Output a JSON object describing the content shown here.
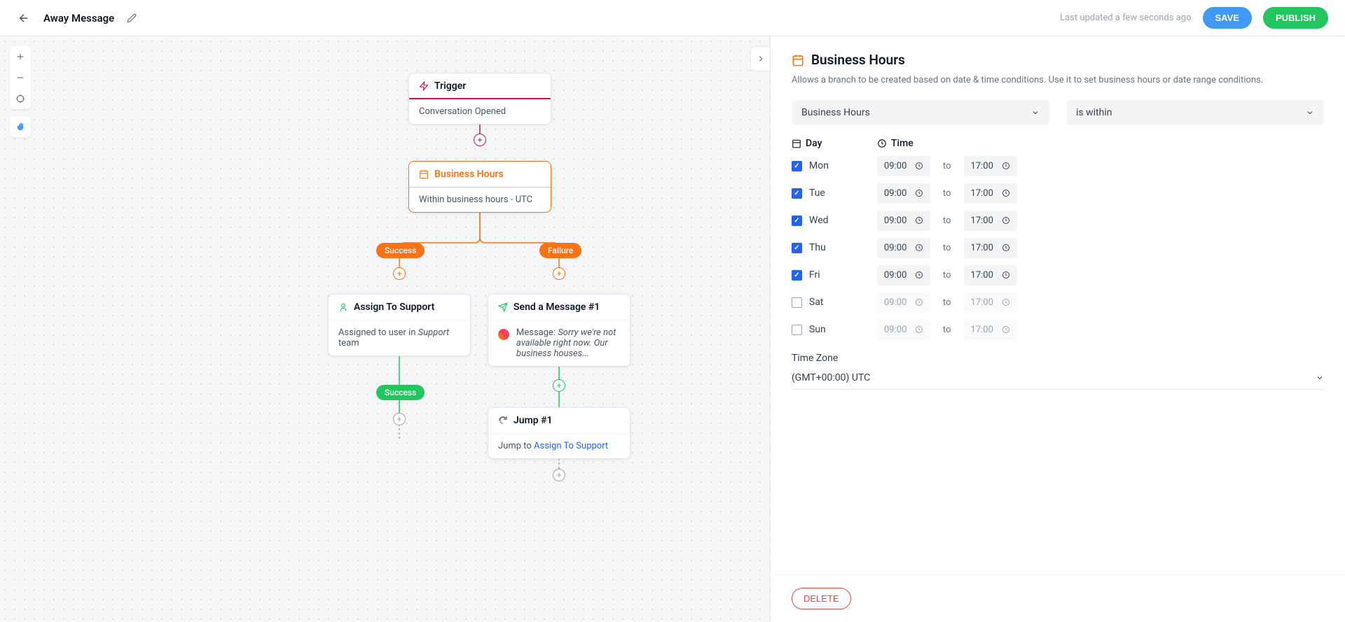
{
  "header": {
    "title": "Away Message",
    "last_updated": "Last updated a few seconds ago",
    "save": "SAVE",
    "publish": "PUBLISH"
  },
  "nodes": {
    "trigger": {
      "title": "Trigger",
      "body": "Conversation Opened"
    },
    "bh": {
      "title": "Business Hours",
      "body": "Within business hours - UTC"
    },
    "assign": {
      "title": "Assign To Support",
      "body_prefix": "Assigned to user in ",
      "team": "Support",
      "body_suffix": " team"
    },
    "msg": {
      "title": "Send a Message #1",
      "label": "Message: ",
      "text": "Sorry we're not available right now. Our business houses..."
    },
    "jump": {
      "title": "Jump #1",
      "prefix": "Jump to ",
      "target": "Assign To Support"
    }
  },
  "badges": {
    "success": "Success",
    "failure": "Failure",
    "success2": "Success"
  },
  "panel": {
    "title": "Business Hours",
    "desc": "Allows a branch to be created based on date & time conditions. Use it to set business hours or date range conditions.",
    "select1": "Business Hours",
    "select2": "is within",
    "hdr_day": "Day",
    "hdr_time": "Time",
    "to": "to",
    "days": [
      {
        "name": "Mon",
        "checked": true,
        "from": "09:00",
        "to": "17:00"
      },
      {
        "name": "Tue",
        "checked": true,
        "from": "09:00",
        "to": "17:00"
      },
      {
        "name": "Wed",
        "checked": true,
        "from": "09:00",
        "to": "17:00"
      },
      {
        "name": "Thu",
        "checked": true,
        "from": "09:00",
        "to": "17:00"
      },
      {
        "name": "Fri",
        "checked": true,
        "from": "09:00",
        "to": "17:00"
      },
      {
        "name": "Sat",
        "checked": false,
        "from": "09:00",
        "to": "17:00"
      },
      {
        "name": "Sun",
        "checked": false,
        "from": "09:00",
        "to": "17:00"
      }
    ],
    "tz_label": "Time Zone",
    "tz_value": "(GMT+00:00) UTC",
    "delete": "DELETE"
  }
}
